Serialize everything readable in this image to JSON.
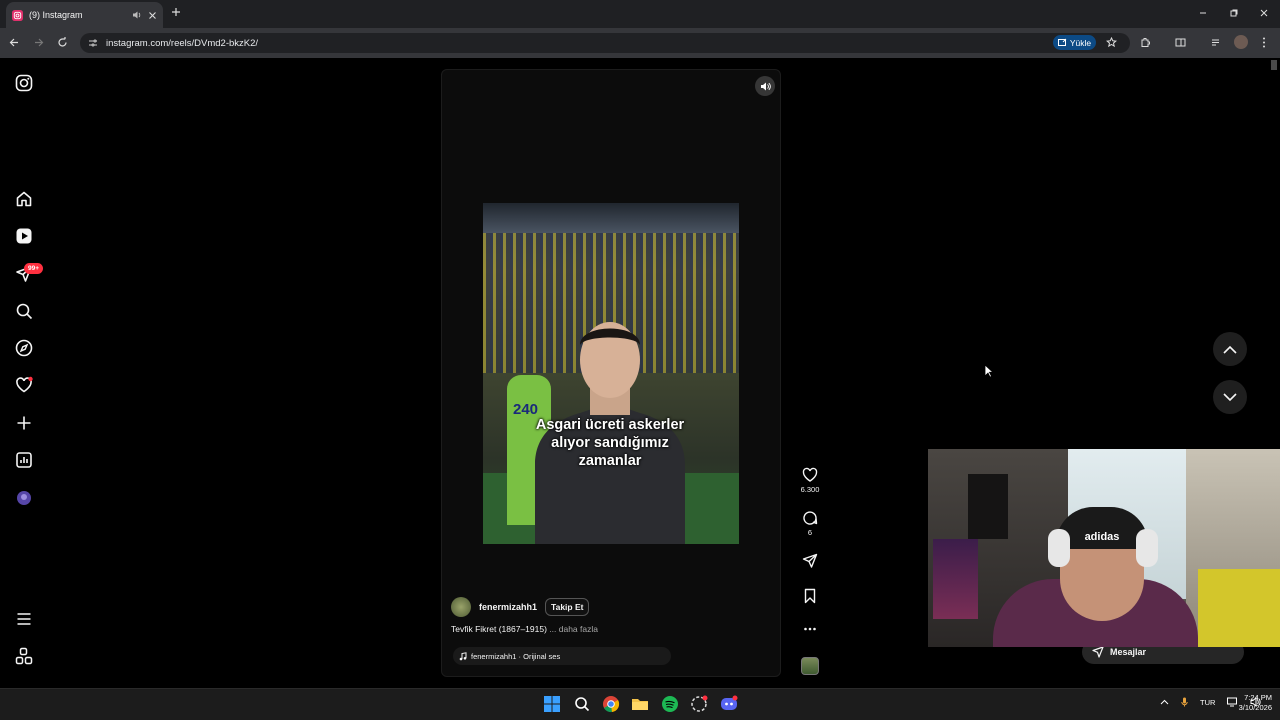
{
  "browser": {
    "tab_title": "(9) Instagram",
    "url": "instagram.com/reels/DVmd2-bkzK2/",
    "upload_label": "Yükle",
    "notification_count": "99+"
  },
  "reel": {
    "caption_line1": "Asgari ücreti askerler",
    "caption_line2": "alıyor sandığımız",
    "caption_line3": "zamanlar",
    "jersey_number": "240",
    "likes": "6.300",
    "comments": "6",
    "author": "fenermizahh1",
    "follow_label": "Takip Et",
    "description": "Tevfik Fikret (1867–1915)",
    "more_label": "... daha fazla",
    "audio_label": "fenermizahh1 · Orijinal ses"
  },
  "webcam": {
    "cap_text": "adidas"
  },
  "messages_label": "Mesajlar",
  "taskbar": {
    "language": "TUR",
    "time": "7:24 PM",
    "date": "3/10/2026"
  },
  "colors": {
    "accent": "#ff3040",
    "chrome_bg": "#35363a",
    "page_bg": "#000000"
  }
}
